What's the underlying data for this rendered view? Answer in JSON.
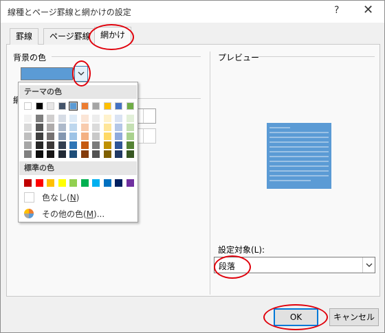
{
  "titlebar": {
    "title": "線種とページ罫線と網かけの設定",
    "help": "?",
    "close": "✕"
  },
  "tabs": [
    {
      "label": "罫線"
    },
    {
      "label": "ページ罫線"
    },
    {
      "label": "網かけ"
    }
  ],
  "background": {
    "label": "背景の色",
    "current_color": "#5b9bd5"
  },
  "pattern_section_label": "網",
  "color_popup": {
    "theme_header": "テーマの色",
    "standard_header": "標準の色",
    "no_color_prefix": "色なし(",
    "no_color_key": "N",
    "no_color_suffix": ")",
    "more_colors_prefix": "その他の色(",
    "more_colors_key": "M",
    "more_colors_suffix": ")...",
    "theme_colors": [
      "#ffffff",
      "#000000",
      "#e7e6e6",
      "#44546a",
      "#5b9bd5",
      "#ed7d31",
      "#a5a5a5",
      "#ffc000",
      "#4472c4",
      "#70ad47"
    ],
    "theme_shades": [
      [
        "#f2f2f2",
        "#7f7f7f",
        "#d0cece",
        "#d6dce5",
        "#deebf7",
        "#fbe5d6",
        "#ededed",
        "#fff2cc",
        "#dae3f3",
        "#e2f0d9"
      ],
      [
        "#d9d9d9",
        "#595959",
        "#aeabab",
        "#adb9ca",
        "#bdd7ee",
        "#f8cbad",
        "#dbdbdb",
        "#ffe699",
        "#b4c7e7",
        "#c5e0b4"
      ],
      [
        "#bfbfbf",
        "#404040",
        "#757171",
        "#8497b0",
        "#9dc3e6",
        "#f4b183",
        "#c9c9c9",
        "#ffd966",
        "#8faadc",
        "#a9d18e"
      ],
      [
        "#a6a6a6",
        "#262626",
        "#3b3838",
        "#333f50",
        "#2e75b6",
        "#c55a11",
        "#7b7b7b",
        "#bf9000",
        "#2f5597",
        "#548235"
      ],
      [
        "#808080",
        "#0d0d0d",
        "#171616",
        "#222a35",
        "#1f4e79",
        "#843c0c",
        "#525252",
        "#7f6000",
        "#203864",
        "#385723"
      ]
    ],
    "standard_colors": [
      "#c00000",
      "#ff0000",
      "#ffc000",
      "#ffff00",
      "#92d050",
      "#00b050",
      "#00b0f0",
      "#0070c0",
      "#002060",
      "#7030a0"
    ]
  },
  "preview": {
    "label": "プレビュー"
  },
  "apply_to": {
    "label": "設定対象(L):",
    "value": "段落"
  },
  "buttons": {
    "ok": "OK",
    "cancel": "キャンセル"
  }
}
